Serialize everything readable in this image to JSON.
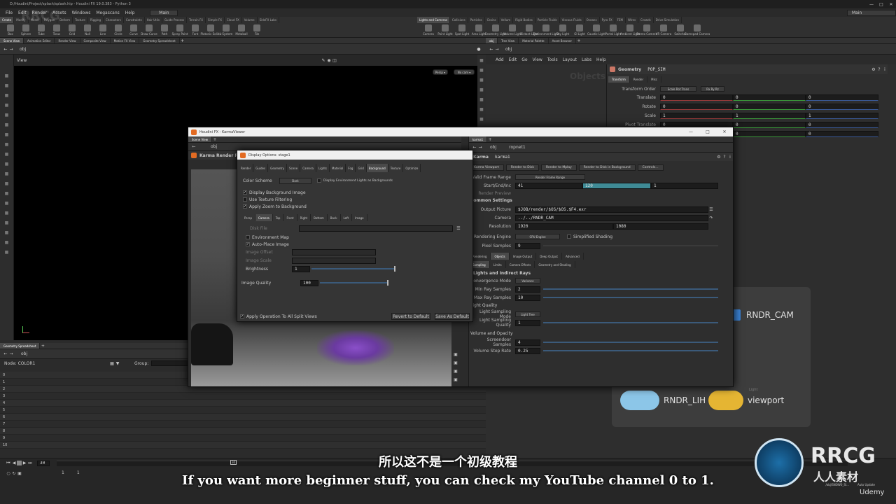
{
  "window": {
    "title": "D:/Houdini/Project/splash/splash.hip - Houdini FX 19.0.383 - Python 3",
    "main_desk": "Main"
  },
  "menubar": {
    "items": [
      "File",
      "Edit",
      "Render",
      "Assets",
      "Windows",
      "Megascans",
      "Help"
    ],
    "desk_label": "Main",
    "build_label": "Main"
  },
  "shelf_tabs_left": [
    "Create",
    "Modify",
    "Model",
    "Polygon",
    "Deform",
    "Texture",
    "Rigging",
    "Characters",
    "Constraints",
    "Hair Utils",
    "Guide Process",
    "Terrain FX",
    "Simple FX",
    "Cloud FX",
    "Volume",
    "SideFX Labs"
  ],
  "shelf_tools_left": [
    "Box",
    "Sphere",
    "Tube",
    "Torus",
    "Grid",
    "Null",
    "Line",
    "Circle",
    "Curve",
    "Draw Curve",
    "Path",
    "Spray Paint",
    "Font",
    "Platonic Solids",
    "L-System",
    "Metaball",
    "File"
  ],
  "shelf_tabs_right": [
    "Lights and Cameras",
    "Collisions",
    "Particles",
    "Grains",
    "Vellum",
    "Rigid Bodies",
    "Particle Fluids",
    "Viscous Fluids",
    "Oceans",
    "Pyro FX",
    "FEM",
    "Wires",
    "Crowds",
    "Drive Simulation"
  ],
  "shelf_tools_right": [
    "Camera",
    "Point Light",
    "Spot Light",
    "Area Light",
    "Geometry Light",
    "Volume Light",
    "Distant Light",
    "Environment Light",
    "Sky Light",
    "GI Light",
    "Caustic Light",
    "Portal Light",
    "Ambient Light",
    "Stereo Camera",
    "VR Camera",
    "Switcher",
    "Gamepad Camera"
  ],
  "left_pane": {
    "tabs": [
      "Scene View",
      "Animation Editor",
      "Render View",
      "Composite View",
      "Motion FX View",
      "Geometry Spreadsheet"
    ],
    "path": "obj",
    "view_label": "View",
    "persp": "Persp ▾",
    "cam": "No cam ▾"
  },
  "spreadsheet": {
    "tab": "Geometry Spreadsheet",
    "path": "obj",
    "node_label": "Node: COLOR1",
    "group_label": "Group:",
    "rows": [
      "0",
      "1",
      "2",
      "3",
      "4",
      "5",
      "6",
      "7",
      "8",
      "9",
      "10"
    ]
  },
  "network": {
    "tabs": [
      "obj",
      "Tree View",
      "Material Palette",
      "Asset Browser"
    ],
    "path": "obj",
    "menu": [
      "Add",
      "Edit",
      "Go",
      "View",
      "Tools",
      "Layout",
      "Labs",
      "Help"
    ],
    "watermark": "Objects",
    "nodes": {
      "cam": "RNDR_CAM",
      "light": "RNDR_LIH",
      "viewport": "viewport",
      "light_small": "Light"
    }
  },
  "params": {
    "type": "Geometry",
    "name": "POP_SIM",
    "tabs": [
      "Transform",
      "Render",
      "Misc"
    ],
    "transform_order_label": "Transform Order",
    "transform_order": "Scale Rot Trans",
    "rot_order": "Rx Ry Rz",
    "rows": [
      {
        "label": "Translate",
        "v": [
          "0",
          "0",
          "0"
        ]
      },
      {
        "label": "Rotate",
        "v": [
          "0",
          "0",
          "0"
        ]
      },
      {
        "label": "Scale",
        "v": [
          "1",
          "1",
          "1"
        ]
      },
      {
        "label": "Pivot Translate",
        "v": [
          "0",
          "0",
          "0"
        ]
      },
      {
        "label": "",
        "v": [
          "0",
          "0",
          "0"
        ]
      }
    ]
  },
  "karma_window": {
    "title": "Houdini FX - KarmaViewer",
    "tab": "Scene View",
    "path": "obj",
    "render_props": "Karma Render Properties"
  },
  "display_options": {
    "title": "Display Options: stage1",
    "tabs": [
      "Render",
      "Guides",
      "Geometry",
      "Scene",
      "Camera",
      "Lights",
      "Material",
      "Fog",
      "Grid",
      "Background",
      "Texture",
      "Optimize"
    ],
    "color_scheme_label": "Color Scheme",
    "color_scheme": "Dark",
    "env_lights": "Display Environment Lights as Backgrounds",
    "checks": [
      "Display Background Image",
      "Use Texture Filtering",
      "Apply Zoom to Background"
    ],
    "view_tabs": [
      "Persp",
      "Camera",
      "Top",
      "Front",
      "Right",
      "Bottom",
      "Back",
      "Left",
      "Image"
    ],
    "disk_file_label": "Disk File",
    "env_map": "Environment Map",
    "auto_place": "Auto-Place Image",
    "image_offset": "Image Offset",
    "image_scale": "Image Scale",
    "brightness_label": "Brightness",
    "brightness": "1",
    "image_quality_label": "Image Quality",
    "image_quality": "100",
    "apply_split": "Apply Operation To All Split Views",
    "revert": "Revert to Default",
    "save_default": "Save As Default"
  },
  "karma_params": {
    "tabs": [
      "karma1"
    ],
    "path": "ropnet1",
    "type": "Karma",
    "name": "karma1",
    "actions": [
      "Karma Viewport",
      "Render to Disk",
      "Render to Mplay",
      "Render to Disk in Background",
      "Controls..."
    ],
    "valid_frame_label": "Valid Frame Range",
    "valid_frame": "Render Frame Range",
    "start_end_label": "Start/End/Inc",
    "start": "41",
    "end": "120",
    "inc": "1",
    "preview_label": "Render Preview",
    "common_header": "Common Settings",
    "output_label": "Output Picture",
    "output": "$JOB/render/$OS/$OS.$F4.exr",
    "camera_label": "Camera",
    "camera": "../../RNDR_CAM",
    "resolution_label": "Resolution",
    "res_x": "1920",
    "res_y": "1080",
    "engine_label": "Rendering Engine",
    "engine": "CPU Engine",
    "simplified": "Simplified Shading",
    "pixel_samples_label": "Pixel Samples",
    "pixel_samples": "9",
    "sub_tabs": [
      "Rendering",
      "Objects",
      "Image Output",
      "Deep Output",
      "Advanced"
    ],
    "sub_tabs2": [
      "Sampling",
      "Limits",
      "Camera Effects",
      "Geometry and Shading"
    ],
    "lights_header": "Lights and Indirect Rays",
    "convergence_label": "Convergence Mode",
    "convergence": "Variance",
    "min_ray_label": "Min Ray Samples",
    "min_ray": "2",
    "max_ray_label": "Max Ray Samples",
    "max_ray": "10",
    "light_quality_header": "Light Quality",
    "light_mode_label": "Light Sampling Mode",
    "light_mode": "Light Tree",
    "light_quality_label": "Light Sampling Quality",
    "light_quality": "1",
    "volume_header": "Volume and Opacity",
    "screendoor_label": "Screendoor Samples",
    "screendoor": "4",
    "vol_step_label": "Volume Step Rate",
    "vol_step": "0.25"
  },
  "timeline": {
    "frame": "30",
    "start": "1",
    "end": "1",
    "marker": "30",
    "status": "/obj/SNOW0_SI...",
    "auto_update": "Auto Update"
  },
  "subtitles": {
    "cn": "所以这不是一个初级教程",
    "en": "If you want more beginner stuff, you can check my YouTube channel 0 to 1."
  },
  "watermarks": {
    "rrcg": "RRCG",
    "cn": "人人素材",
    "udemy": "Udemy"
  }
}
